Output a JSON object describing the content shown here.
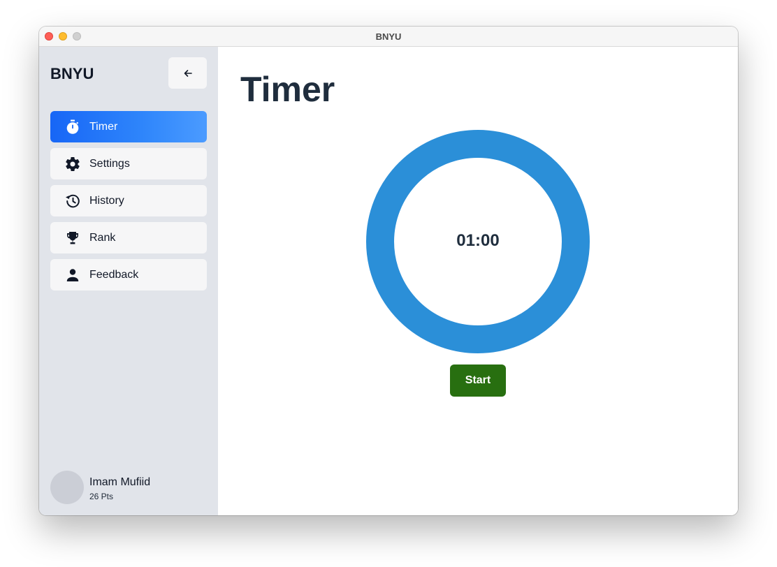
{
  "window": {
    "title": "BNYU"
  },
  "sidebar": {
    "brand": "BNYU",
    "collapse_icon": "arrow-left-icon",
    "items": [
      {
        "label": "Timer",
        "icon": "stopwatch-icon",
        "active": true
      },
      {
        "label": "Settings",
        "icon": "gear-icon",
        "active": false
      },
      {
        "label": "History",
        "icon": "history-icon",
        "active": false
      },
      {
        "label": "Rank",
        "icon": "trophy-icon",
        "active": false
      },
      {
        "label": "Feedback",
        "icon": "person-icon",
        "active": false
      }
    ],
    "user": {
      "name": "Imam Mufiid",
      "points": "26 Pts"
    }
  },
  "main": {
    "title": "Timer",
    "timer": {
      "display": "01:00",
      "ring_color": "#2b8fd8"
    },
    "start_label": "Start"
  },
  "colors": {
    "accent": "#1766f6",
    "start_button": "#286f10",
    "sidebar_bg": "#e1e4ea"
  }
}
